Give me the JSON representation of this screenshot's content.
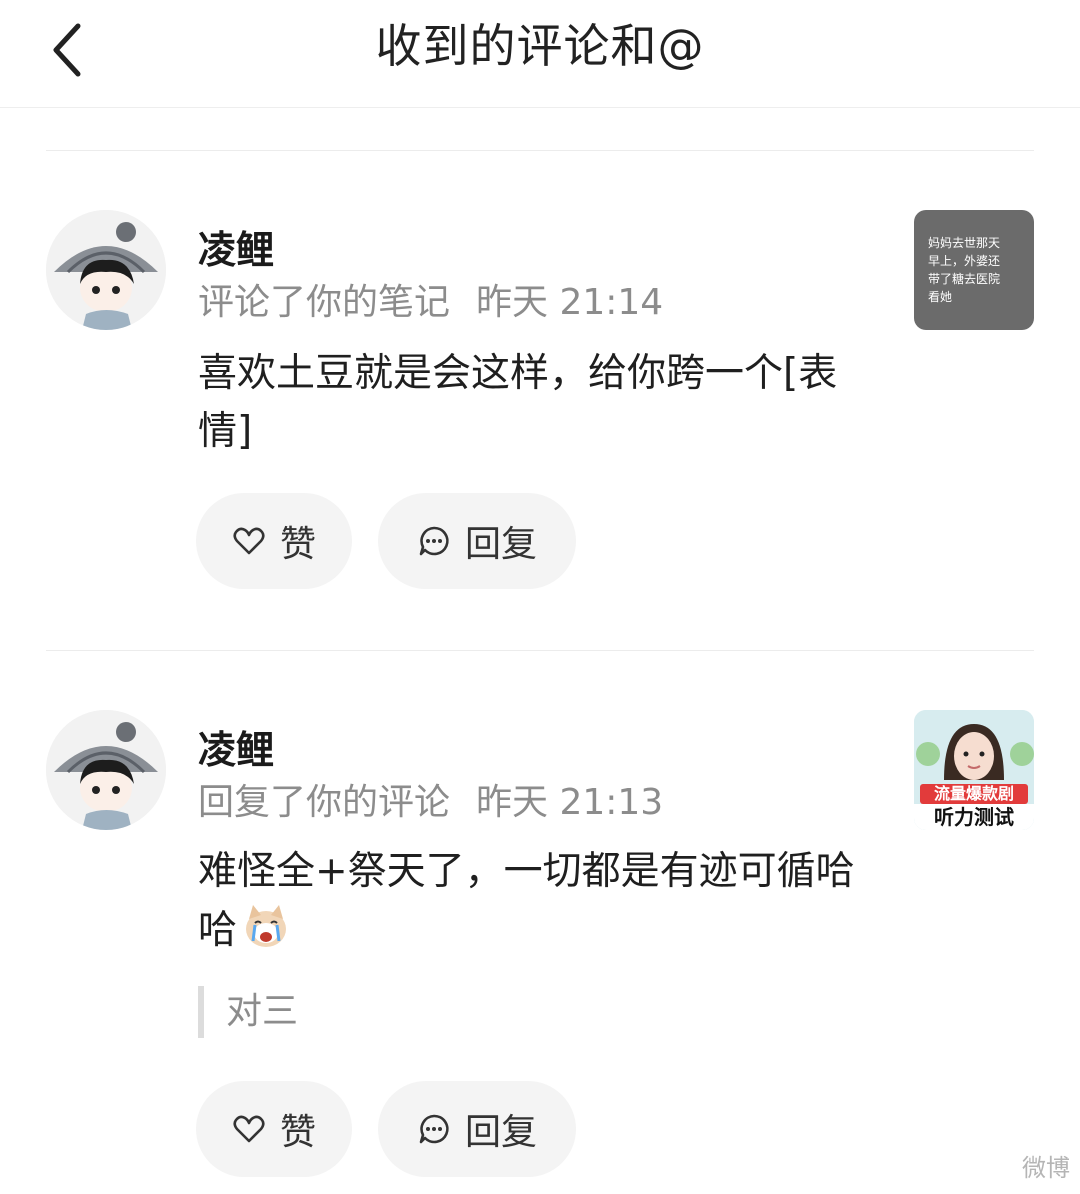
{
  "header": {
    "title": "收到的评论和@"
  },
  "notifications": [
    {
      "username": "凌鲤",
      "action": "评论了你的笔记",
      "time": "昨天 21:14",
      "content": "喜欢土豆就是会这样，给你跨一个[表情]",
      "thumbnail": {
        "type": "text",
        "lines": [
          "妈妈去世那天",
          "早上，外婆还",
          "带了糖去医院",
          "看她"
        ]
      },
      "like_label": "赞",
      "reply_label": "回复"
    },
    {
      "username": "凌鲤",
      "action": "回复了你的评论",
      "time": "昨天 21:13",
      "content": "难怪全+祭天了，一切都是有迹可循哈哈",
      "emoji_icon": "crying-dog-emoji",
      "quote": "对三",
      "thumbnail": {
        "type": "image",
        "banner": "流量爆款剧",
        "banner2": "听力测试"
      },
      "like_label": "赞",
      "reply_label": "回复"
    }
  ],
  "watermark": "微博",
  "colors": {
    "background": "#ffffff",
    "button_bg": "#f4f4f4",
    "meta_text": "#8c8c8c",
    "divider": "#ececec"
  }
}
